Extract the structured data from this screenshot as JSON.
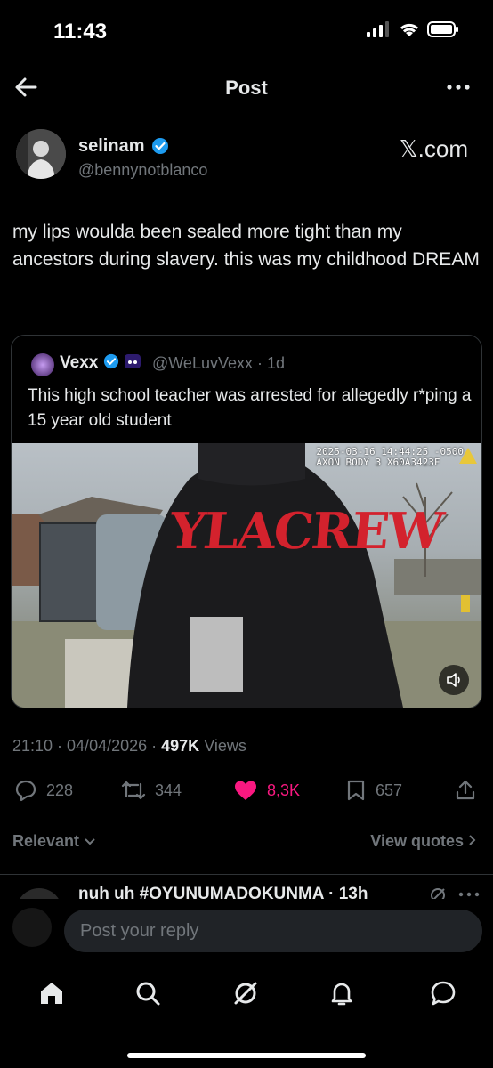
{
  "status": {
    "time": "11:43"
  },
  "header": {
    "title": "Post"
  },
  "author": {
    "name": "selinam",
    "handle": "@bennynotblanco",
    "source": "𝕏.com"
  },
  "post": {
    "text": "my lips woulda been sealed more tight than my ancestors during slavery. this was my childhood DREAM"
  },
  "quote": {
    "name": "Vexx",
    "handle": "@WeLuvVexx · 1d",
    "text": "This high school teacher was arrested for allegedly r*ping a 15 year old student",
    "video_overlay_line1": "2025-03-16 14:44:25 -0500",
    "video_overlay_line2": "AXON BODY 3 X60A3423F",
    "hoodie_text": "YLACREW"
  },
  "meta": {
    "time": "21:10 · 04/04/2026 ·",
    "views_count": "497K",
    "views_label": "Views"
  },
  "actions": {
    "replies": "228",
    "reposts": "344",
    "likes": "8,3K",
    "bookmarks": "657"
  },
  "sort": {
    "relevant": "Relevant",
    "view_quotes": "View quotes"
  },
  "reply_preview": {
    "name": "nuh uh #OYUNUMADOKUNMA · 13h"
  },
  "composer": {
    "placeholder": "Post your reply"
  },
  "colors": {
    "like": "#f91880",
    "verified": "#1d9bf0",
    "background": "#000000",
    "muted": "#71767b"
  }
}
